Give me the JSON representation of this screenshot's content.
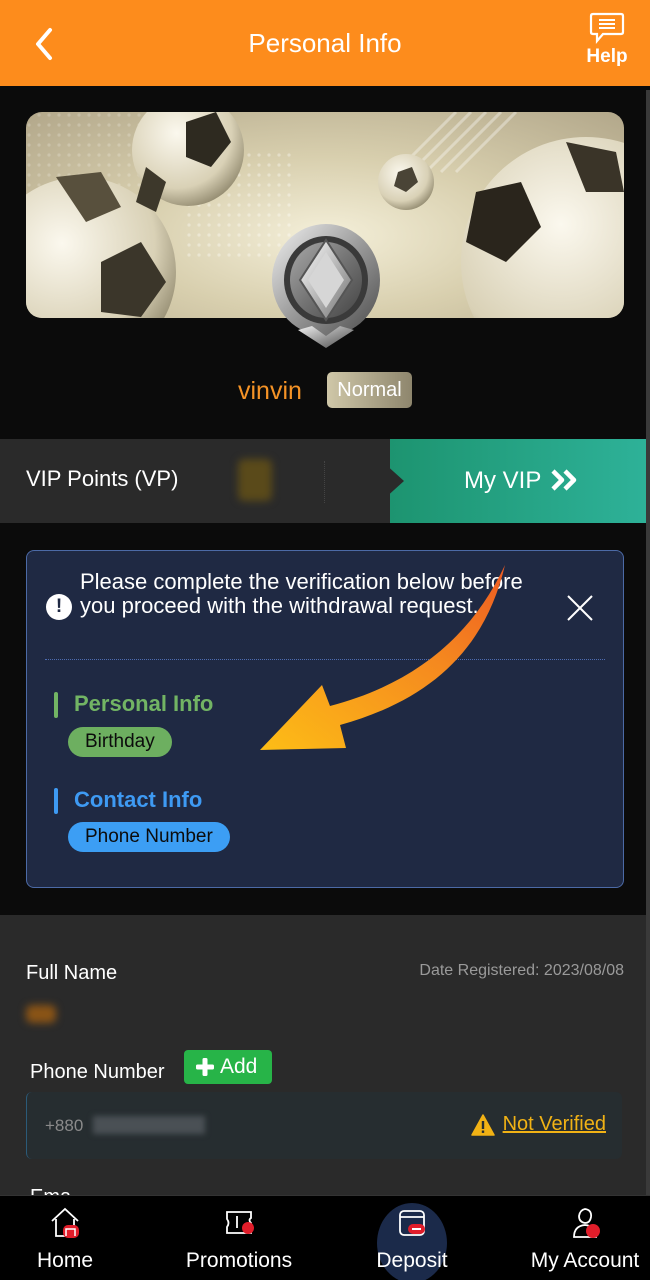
{
  "header": {
    "title": "Personal Info",
    "back_icon": "chevron-left-icon",
    "help_label": "Help",
    "help_icon": "chat-bubble-icon"
  },
  "profile": {
    "username": "vinvin",
    "level": "Normal",
    "medal_icon": "silver-diamond-medal-icon"
  },
  "vip": {
    "label": "VIP Points (VP)",
    "value": "",
    "button_label": "My VIP",
    "button_icon": "double-chevron-right-icon"
  },
  "verification": {
    "message": "Please complete the verification below before you proceed with the withdrawal request.",
    "sections": [
      {
        "title": "Personal Info",
        "chip": "Birthday",
        "color": "#72b464"
      },
      {
        "title": "Contact Info",
        "chip": "Phone Number",
        "color": "#3e9af3"
      }
    ]
  },
  "form": {
    "full_name_label": "Full Name",
    "date_registered": "Date Registered: 2023/08/08",
    "phone_label": "Phone Number",
    "add_label": "Add",
    "phone_prefix": "+880",
    "phone_status": "Not Verified",
    "next_label_peek": "Email"
  },
  "bottom_nav": {
    "items": [
      {
        "label": "Home",
        "icon": "home-icon"
      },
      {
        "label": "Promotions",
        "icon": "ticket-icon"
      },
      {
        "label": "Deposit",
        "icon": "wallet-card-icon",
        "active": true
      },
      {
        "label": "My Account",
        "icon": "user-icon"
      }
    ]
  },
  "colors": {
    "header_orange": "#fd8c1c",
    "vip_green": "#1d9470",
    "panel_bg": "#1f2943",
    "warning_yellow": "#f1b215",
    "add_green": "#27b448",
    "username_orange": "#f59326"
  }
}
